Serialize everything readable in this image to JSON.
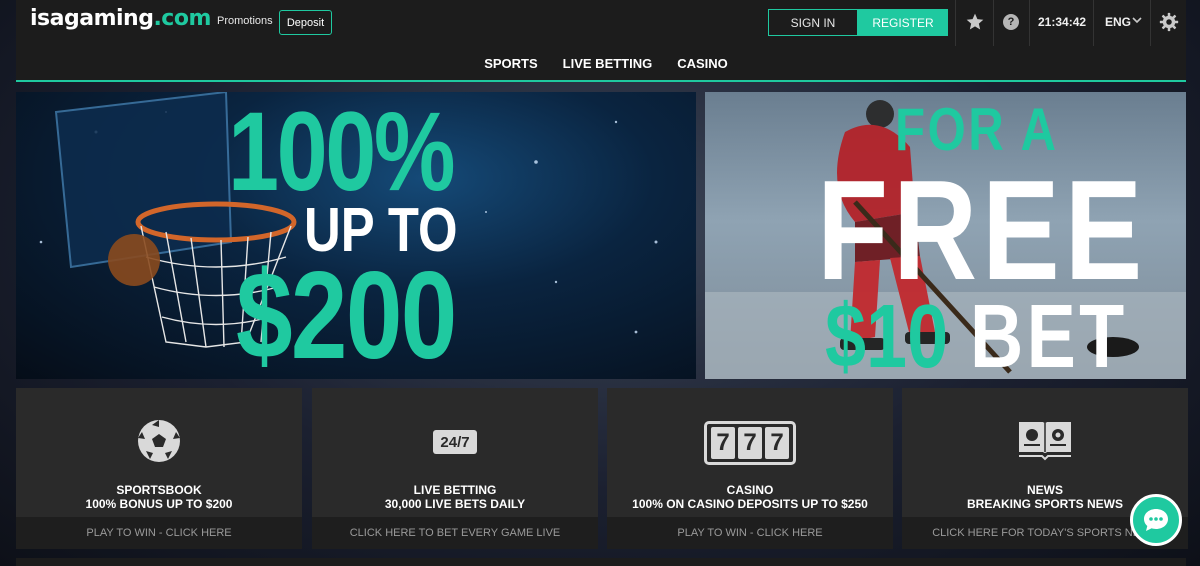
{
  "header": {
    "logo_main": "isagaming",
    "logo_suffix": ".com",
    "promotions_label": "Promotions",
    "deposit_label": "Deposit",
    "signin_label": "SIGN IN",
    "register_label": "REGISTER",
    "help_glyph": "?",
    "time": "21:34:42",
    "language": "ENG",
    "icons": [
      "star-icon",
      "help-icon",
      "chevron-down-icon",
      "gear-icon"
    ]
  },
  "nav": {
    "items": [
      "SPORTS",
      "LIVE BETTING",
      "CASINO"
    ]
  },
  "banners": {
    "left": {
      "line1": "100%",
      "line2": "UP TO",
      "line3": "$200"
    },
    "right": {
      "line1": "FOR A",
      "line2": "FREE",
      "line3a": "$10",
      "line3b": "BET"
    }
  },
  "tiles": [
    {
      "icon": "soccer-ball-icon",
      "title": "SPORTSBOOK",
      "subtitle": "100% BONUS UP TO $200",
      "cta": "PLAY TO WIN - CLICK HERE"
    },
    {
      "icon": "24-7-icon",
      "icon_text": "24/7",
      "title": "LIVE BETTING",
      "subtitle": "30,000 LIVE BETS DAILY",
      "cta": "CLICK HERE TO BET EVERY GAME LIVE"
    },
    {
      "icon": "slot-machine-icon",
      "icon_text": "777",
      "title": "CASINO",
      "subtitle": "100% ON CASINO DEPOSITS UP TO $250",
      "cta": "PLAY TO WIN - CLICK HERE"
    },
    {
      "icon": "news-book-icon",
      "title": "NEWS",
      "subtitle": "BREAKING SPORTS NEWS",
      "cta": "CLICK HERE FOR TODAY'S SPORTS NEWS"
    }
  ],
  "colors": {
    "accent": "#1fc9a0",
    "topbar": "#1c1c1c",
    "tile_bg": "#2a2a2a"
  },
  "chat": {
    "icon": "chat-bubble-icon"
  }
}
